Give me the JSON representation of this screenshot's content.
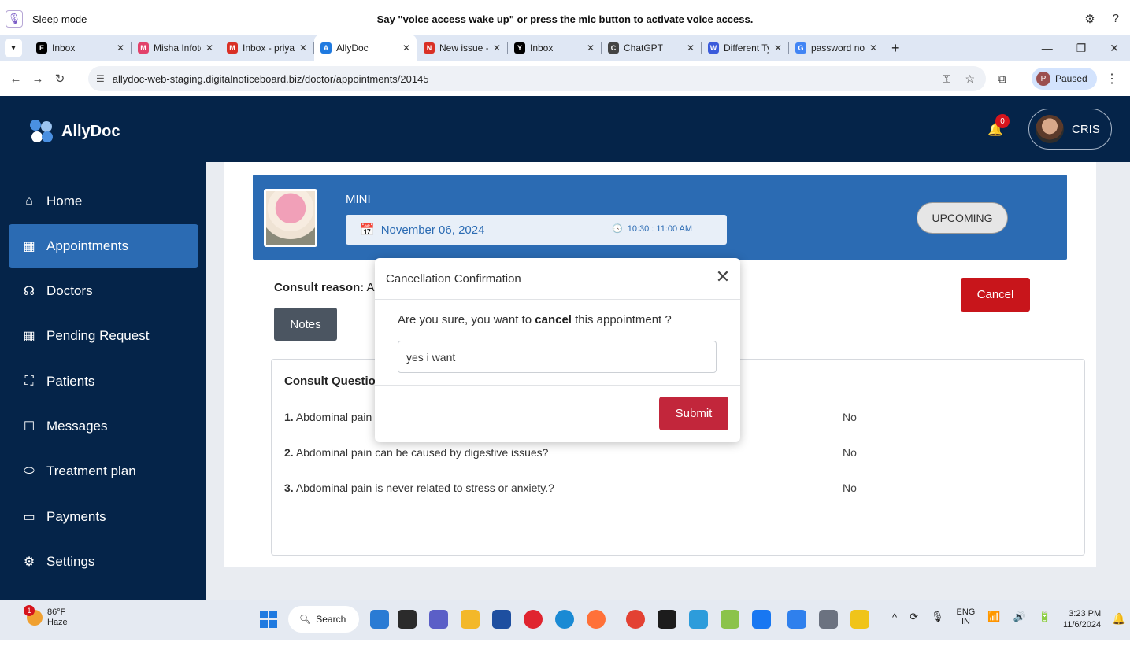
{
  "voice_bar": {
    "mode": "Sleep mode",
    "message": "Say \"voice access wake up\" or press the mic button to activate voice access.",
    "mic_icon": "mic-icon",
    "settings_icon": "gear-icon",
    "help_icon": "help-icon"
  },
  "tabs": [
    {
      "title": "Inbox",
      "favicon_color": "#000000",
      "favicon": "E"
    },
    {
      "title": "Misha Infotec",
      "favicon_color": "#e2416a",
      "favicon": "M"
    },
    {
      "title": "Inbox - priyan",
      "favicon_color": "#d93025",
      "favicon": "M"
    },
    {
      "title": "AllyDoc",
      "favicon_color": "#1f7ae0",
      "favicon": "A",
      "active": true
    },
    {
      "title": "New issue - A",
      "favicon_color": "#d93025",
      "favicon": "N"
    },
    {
      "title": "Inbox",
      "favicon_color": "#000000",
      "favicon": "Y"
    },
    {
      "title": "ChatGPT",
      "favicon_color": "#444444",
      "favicon": "C"
    },
    {
      "title": "Different Typ",
      "favicon_color": "#3b5bdb",
      "favicon": "W"
    },
    {
      "title": "password no",
      "favicon_color": "#4285f4",
      "favicon": "G"
    }
  ],
  "address_bar": {
    "url": "allydoc-web-staging.digitalnoticeboard.biz/doctor/appointments/20145",
    "profile_label": "Paused",
    "profile_initial": "P"
  },
  "app": {
    "brand": "AllyDoc",
    "notification_count": "0",
    "user_name": "CRIS"
  },
  "sidebar": {
    "items": [
      {
        "label": "Home",
        "icon": "home-icon"
      },
      {
        "label": "Appointments",
        "icon": "calendar-icon",
        "active": true
      },
      {
        "label": "Doctors",
        "icon": "stethoscope-icon"
      },
      {
        "label": "Pending Request",
        "icon": "calendar-icon"
      },
      {
        "label": "Patients",
        "icon": "bed-icon"
      },
      {
        "label": "Messages",
        "icon": "message-icon"
      },
      {
        "label": "Treatment plan",
        "icon": "pill-icon"
      },
      {
        "label": "Payments",
        "icon": "card-icon"
      },
      {
        "label": "Settings",
        "icon": "gear-icon"
      }
    ]
  },
  "appointment": {
    "patient_name": "MINI",
    "date": "November 06, 2024",
    "time": "10:30 : 11:00 AM",
    "status": "UPCOMING",
    "reason_label": "Consult reason:",
    "reason_value": "Abdo",
    "cancel_label": "Cancel",
    "notes_label": "Notes"
  },
  "questionnaire": {
    "title": "Consult Questionn",
    "rows": [
      {
        "num": "1.",
        "text": "Abdominal pain is a",
        "answer": "No"
      },
      {
        "num": "2.",
        "text": "Abdominal pain can be caused by digestive issues?",
        "answer": "No"
      },
      {
        "num": "3.",
        "text": "Abdominal pain is never related to stress or anxiety.?",
        "answer": "No"
      }
    ]
  },
  "modal": {
    "title": "Cancellation Confirmation",
    "question_before": "Are you sure, you want to ",
    "question_bold": "cancel",
    "question_after": " this appointment ?",
    "input_value": "yes i want",
    "submit_label": "Submit",
    "close_symbol": "✕"
  },
  "taskbar": {
    "temperature": "86°F",
    "condition": "Haze",
    "weather_badge": "1",
    "search_label": "Search",
    "lang_top": "ENG",
    "lang_bottom": "IN",
    "time": "3:23 PM",
    "date": "11/6/2024"
  }
}
